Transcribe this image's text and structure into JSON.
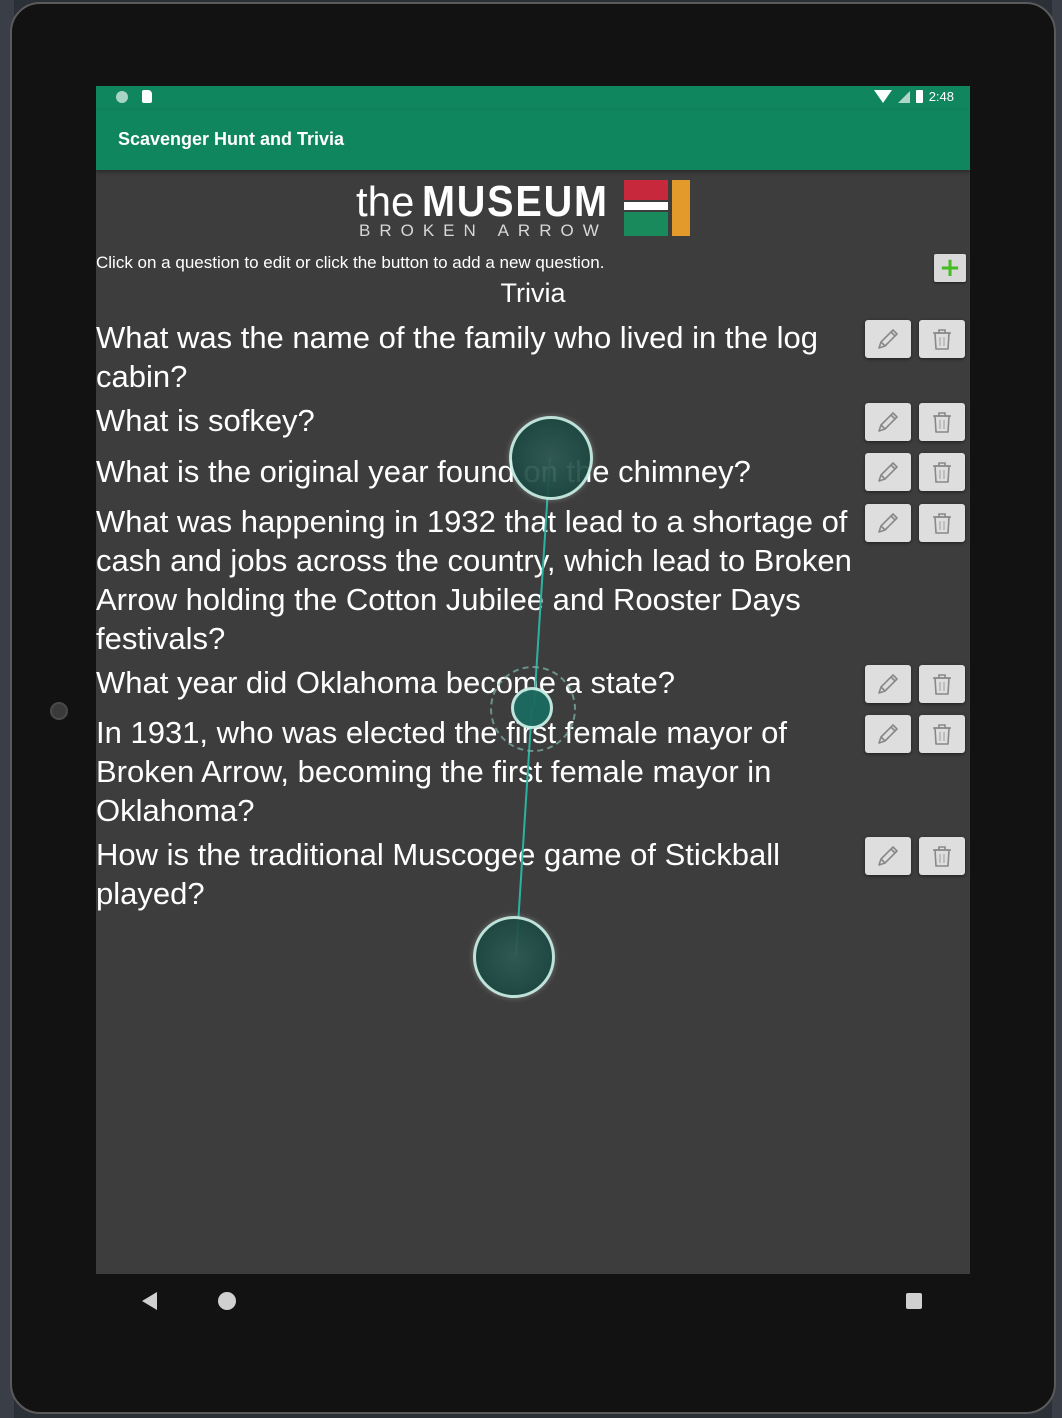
{
  "status_bar": {
    "time": "2:48"
  },
  "app_bar": {
    "title": "Scavenger Hunt and Trivia"
  },
  "logo": {
    "the": "the",
    "museum": "MUSEUM",
    "subtitle": "BROKEN ARROW"
  },
  "instructions": "Click on a question to edit or click the button to add a new question.",
  "add_button": {
    "label": "+"
  },
  "section_title": "Trivia",
  "questions": [
    {
      "text": "What was the name of the family who lived in the log cabin?"
    },
    {
      "text": "What is sofkey?"
    },
    {
      "text": "What is the original year found on the chimney?"
    },
    {
      "text": "What was happening in 1932 that lead to a shortage of cash and jobs across the country, which lead to Broken Arrow holding the Cotton Jubilee and Rooster Days festivals?"
    },
    {
      "text": "What year did Oklahoma become a state?"
    },
    {
      "text": "In 1931, who was elected the first female mayor of Broken Arrow, becoming the first female mayor in Oklahoma?"
    },
    {
      "text": "How is the traditional Muscogee game of Stickball played?"
    }
  ],
  "icons": {
    "edit": "pencil-icon",
    "delete": "trash-icon",
    "back": "back-icon",
    "home": "home-icon",
    "recents": "recents-icon"
  },
  "colors": {
    "app_bar": "#10865f",
    "background": "#3d3d3d",
    "add_plus": "#44bb22",
    "logo_red": "#c8283c",
    "logo_green": "#188a5c",
    "logo_orange": "#e39a2a"
  }
}
